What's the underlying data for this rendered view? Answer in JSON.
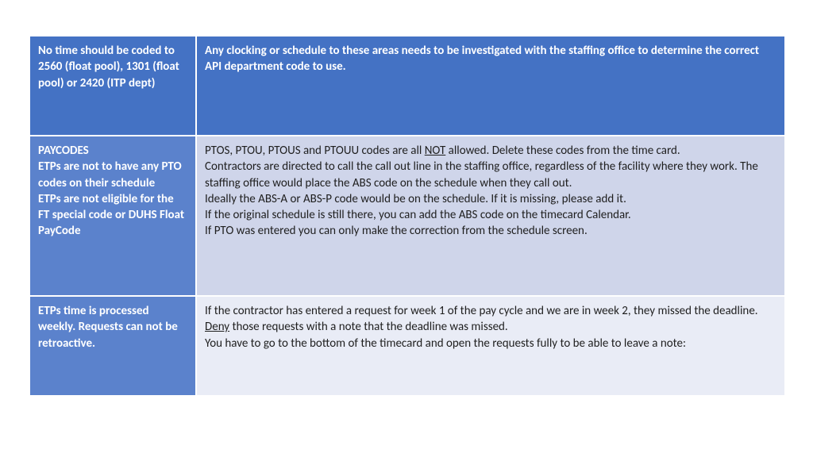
{
  "rows": [
    {
      "left": "No time should be coded to 2560 (float pool), 1301  (float pool) or 2420 (ITP dept)",
      "right": "Any clocking or schedule to these areas needs to be investigated with the staffing office to determine the correct API department code to use."
    },
    {
      "left_lines": [
        "PAYCODES",
        "ETPs are not to have any PTO codes on their schedule",
        "ETPs are not eligible for the FT special code or DUHS Float PayCode"
      ],
      "right_line1_pre": "PTOS, PTOU, PTOUS and PTOUU codes are all ",
      "right_line1_u": "NOT",
      "right_line1_post": " allowed.  Delete these codes from the time card.",
      "right_lines_rest": [
        "Contractors are directed to call the call out line in the staffing office, regardless of the facility where they work.  The staffing office would place the ABS code on the schedule when they call out.",
        "Ideally the ABS-A or ABS-P code would be on the schedule.  If it is missing, please add it.",
        "If the original schedule is still there, you can add the ABS code on the timecard Calendar.",
        "If PTO was entered you can only make the correction from the schedule screen."
      ]
    },
    {
      "left": "ETPs time is processed weekly.  Requests can not be retroactive.",
      "right_line1_pre": "If the contractor has entered a request for week 1 of the pay cycle and we are in week 2, they missed the deadline.  ",
      "right_line1_u": "Deny",
      "right_line1_post": " those requests with a note that the deadline was missed.",
      "right_line2": "You have to go to the bottom of the timecard and open the requests fully to be able to leave a note:"
    }
  ]
}
